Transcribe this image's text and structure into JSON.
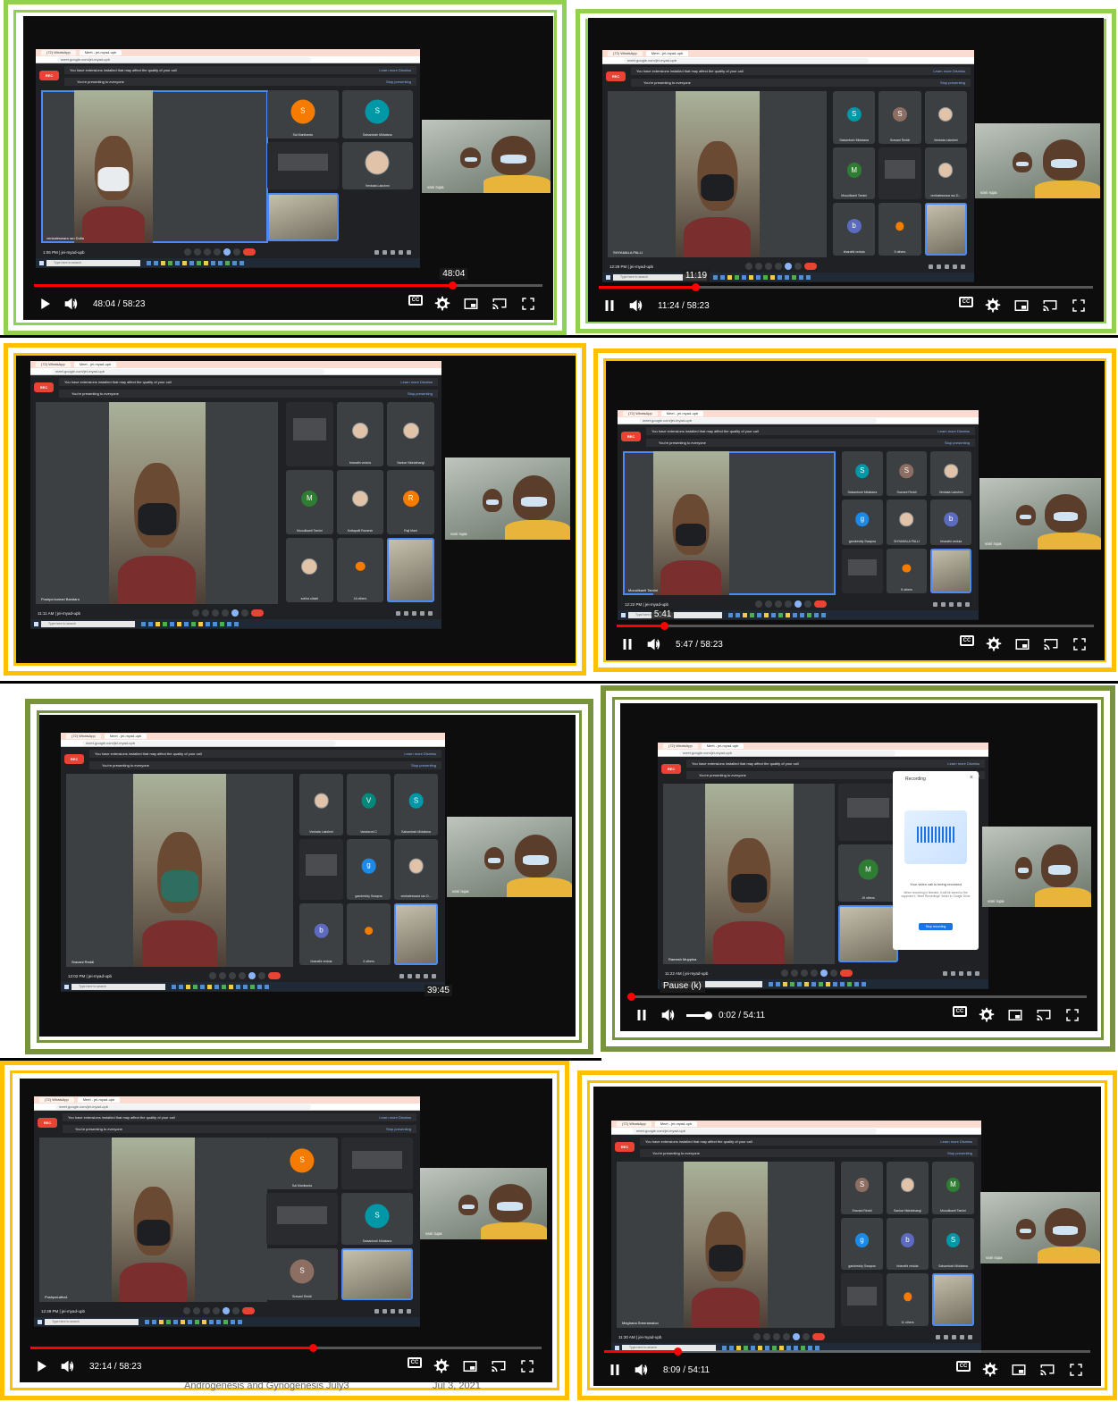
{
  "colors": {
    "green_border": "#92d050",
    "gold_border": "#ffc000",
    "olive_border": "#77933c",
    "youtube_red": "#ff0000",
    "meet_rec_red": "#ea4335",
    "meet_blue": "#4c8bf5"
  },
  "common": {
    "tab_whatsapp": "(72) WhatsApp",
    "tab_meet": "Meet - jei-myad-upb",
    "url": "meet.google.com/jei-myad-upb",
    "rec_label": "REC",
    "extension_notice": "You have extensions installed that may affect the quality of your call",
    "learn_more": "Learn more",
    "dismiss": "Dismiss",
    "presenting": "You're presenting to everyone",
    "stop_presenting": "Stop presenting",
    "meeting_code": "jei-myad-upb",
    "taskbar_search": "Type here to search",
    "cc": "CC"
  },
  "panels": [
    {
      "id": "p1",
      "border": "green",
      "speaker": "venkateswara rao Dulla",
      "clock": "1:06 PM",
      "tiles": [
        {
          "name": "Sai Manikanta",
          "initial": "S",
          "color": "#f57c00"
        },
        {
          "name": "Saisantosh Midatana",
          "initial": "S",
          "color": "#0097a7"
        },
        {
          "name": "",
          "initial": "",
          "color": "",
          "kind": "screen"
        },
        {
          "name": "Venkata Lakshmi",
          "initial": "",
          "color": "",
          "kind": "photo"
        },
        {
          "name": "",
          "initial": "",
          "color": "",
          "kind": "self"
        }
      ],
      "cam_label": "vani rupa",
      "tooltip": "48:04",
      "time": "48:04 / 58:23",
      "progress": 0.823,
      "playing": false
    },
    {
      "id": "p2",
      "border": "green",
      "speaker": "SHYAMALA PALLI",
      "clock": "12:28 PM",
      "tiles": [
        {
          "name": "Saisantosh Midatana",
          "initial": "S",
          "color": "#0097a7"
        },
        {
          "name": "Sravani Reddi",
          "initial": "S",
          "color": "#8d6e63"
        },
        {
          "name": "Venkata Lakshmi",
          "initial": "",
          "color": "",
          "kind": "photo"
        },
        {
          "name": "Mouulikanti Tamini",
          "initial": "M",
          "color": "#2e7d32"
        },
        {
          "name": "",
          "initial": "",
          "color": "",
          "kind": "screen"
        },
        {
          "name": "venkateswara rao D...",
          "initial": "",
          "color": "",
          "kind": "photo"
        },
        {
          "name": "bharathi vedula",
          "initial": "b",
          "color": "#5c6bc0"
        },
        {
          "name": "5 others",
          "initial": "",
          "color": "",
          "kind": "others"
        },
        {
          "name": "",
          "initial": "",
          "color": "",
          "kind": "self"
        }
      ],
      "cam_label": "vani rupa",
      "tooltip": "11:19",
      "time": "11:24 / 58:23",
      "progress": 0.195,
      "playing": true
    },
    {
      "id": "p3",
      "border": "gold",
      "speaker": "Pushpa kumari Bandaru",
      "clock": "11:11 AM",
      "tiles": [
        {
          "name": "",
          "initial": "",
          "color": "",
          "kind": "screen"
        },
        {
          "name": "bharathi vedula",
          "initial": "",
          "color": "",
          "kind": "photo"
        },
        {
          "name": "Sankar Nidrabhangi",
          "initial": "",
          "color": "",
          "kind": "photo"
        },
        {
          "name": "Mouulikanti Tamini",
          "initial": "M",
          "color": "#2e7d32"
        },
        {
          "name": "Kuttapalli Ramesh",
          "initial": "",
          "color": "",
          "kind": "photo"
        },
        {
          "name": "Raji Marri",
          "initial": "R",
          "color": "#f57c00"
        },
        {
          "name": "sobha ullasti",
          "initial": "",
          "color": "",
          "kind": "photo"
        },
        {
          "name": "16 others",
          "initial": "",
          "color": "",
          "kind": "others"
        },
        {
          "name": "",
          "initial": "",
          "color": "",
          "kind": "self"
        }
      ],
      "cam_label": "vani rupa"
    },
    {
      "id": "p4",
      "border": "gold",
      "speaker": "Mouulikanti Tamini",
      "clock": "12:22 PM",
      "tiles": [
        {
          "name": "Saisantosh Midatana",
          "initial": "S",
          "color": "#0097a7"
        },
        {
          "name": "Sravani Reddi",
          "initial": "S",
          "color": "#8d6e63"
        },
        {
          "name": "Venkata Lakshmi",
          "initial": "",
          "color": "",
          "kind": "photo"
        },
        {
          "name": "gandreddy Swapna",
          "initial": "g",
          "color": "#1e88e5"
        },
        {
          "name": "SHYAMALA PALLI",
          "initial": "",
          "color": "",
          "kind": "photo"
        },
        {
          "name": "bharathi vedula",
          "initial": "b",
          "color": "#5c6bc0"
        },
        {
          "name": "",
          "initial": "",
          "color": "",
          "kind": "screen"
        },
        {
          "name": "5 others",
          "initial": "",
          "color": "",
          "kind": "others"
        },
        {
          "name": "",
          "initial": "",
          "color": "",
          "kind": "self"
        }
      ],
      "cam_label": "vani rupa",
      "tooltip": "5:41",
      "time": "5:47 / 58:23",
      "progress": 0.099,
      "playing": true
    },
    {
      "id": "p5",
      "border": "olive",
      "speaker": "Sravani Reddi",
      "clock": "12:02 PM",
      "tiles": [
        {
          "name": "Venkata Lakshmi",
          "initial": "",
          "color": "",
          "kind": "photo"
        },
        {
          "name": "Varalaxmi C",
          "initial": "V",
          "color": "#00897b"
        },
        {
          "name": "Saisantosh Midatana",
          "initial": "S",
          "color": "#0097a7"
        },
        {
          "name": "",
          "initial": "",
          "color": "",
          "kind": "screen"
        },
        {
          "name": "gandreddy Swapna",
          "initial": "g",
          "color": "#1e88e5"
        },
        {
          "name": "venkateswara rao D...",
          "initial": "",
          "color": "",
          "kind": "photo"
        },
        {
          "name": "bharathi vedula",
          "initial": "b",
          "color": "#5c6bc0"
        },
        {
          "name": "4 others",
          "initial": "",
          "color": "",
          "kind": "others"
        },
        {
          "name": "",
          "initial": "",
          "color": "",
          "kind": "self"
        }
      ],
      "cam_label": "vani rupa",
      "tooltip": "39:45"
    },
    {
      "id": "p6",
      "border": "olive",
      "speaker": "Ramesh Muppina",
      "clock": "11:22 AM",
      "tiles": [
        {
          "name": "",
          "initial": "",
          "color": "",
          "kind": "screen"
        },
        {
          "name": "19 others",
          "initial": "M",
          "color": "#2e7d32"
        },
        {
          "name": "",
          "initial": "",
          "color": "",
          "kind": "self"
        }
      ],
      "cam_label": "vani rupa",
      "recording_title": "Recording",
      "recording_text": "Your video call is being recorded",
      "recording_sub": "When recording is finished, it will be saved to the organizer's \"Meet Recordings\" folder in Google Drive",
      "recording_btn": "Stop recording",
      "tooltip": "Pause (k)",
      "time": "0:02 / 54:11",
      "progress": 0.0006,
      "playing": true
    },
    {
      "id": "p7",
      "border": "gold",
      "speaker": "PushpaLatha1",
      "clock": "12:49 PM",
      "tiles": [
        {
          "name": "Sai Manikanta",
          "initial": "S",
          "color": "#f57c00"
        },
        {
          "name": "",
          "initial": "",
          "color": "",
          "kind": "screen"
        },
        {
          "name": "",
          "initial": "",
          "color": "",
          "kind": "screen"
        },
        {
          "name": "Saisantosh Midatana",
          "initial": "S",
          "color": "#0097a7"
        },
        {
          "name": "Sravani Reddi",
          "initial": "S",
          "color": "#8d6e63"
        },
        {
          "name": "",
          "initial": "",
          "color": "",
          "kind": "self"
        }
      ],
      "cam_label": "vani rupa",
      "time": "32:14 / 58:23",
      "progress": 0.552,
      "playing": false,
      "bg_title": "Androgenesis and Gynogenesis July3",
      "bg_date": "Jul 3, 2021"
    },
    {
      "id": "p8",
      "border": "gold",
      "speaker": "Meghana Sreeramaloo",
      "clock": "11:30 AM",
      "tiles": [
        {
          "name": "Sravani Reddi",
          "initial": "S",
          "color": "#8d6e63"
        },
        {
          "name": "Sankar Nidrabhangi",
          "initial": "",
          "color": "",
          "kind": "photo"
        },
        {
          "name": "Mouulikanti Tamini",
          "initial": "M",
          "color": "#2e7d32"
        },
        {
          "name": "gandreddy Swapna",
          "initial": "g",
          "color": "#1e88e5"
        },
        {
          "name": "bharathi vedula",
          "initial": "b",
          "color": "#5c6bc0"
        },
        {
          "name": "Saisantosh Midatana",
          "initial": "S",
          "color": "#0097a7"
        },
        {
          "name": "",
          "initial": "",
          "color": "",
          "kind": "screen"
        },
        {
          "name": "11 others",
          "initial": "",
          "color": "",
          "kind": "others"
        },
        {
          "name": "",
          "initial": "",
          "color": "",
          "kind": "self"
        }
      ],
      "cam_label": "vani rupa",
      "time": "8:09 / 54:11",
      "progress": 0.15,
      "playing": true
    }
  ]
}
